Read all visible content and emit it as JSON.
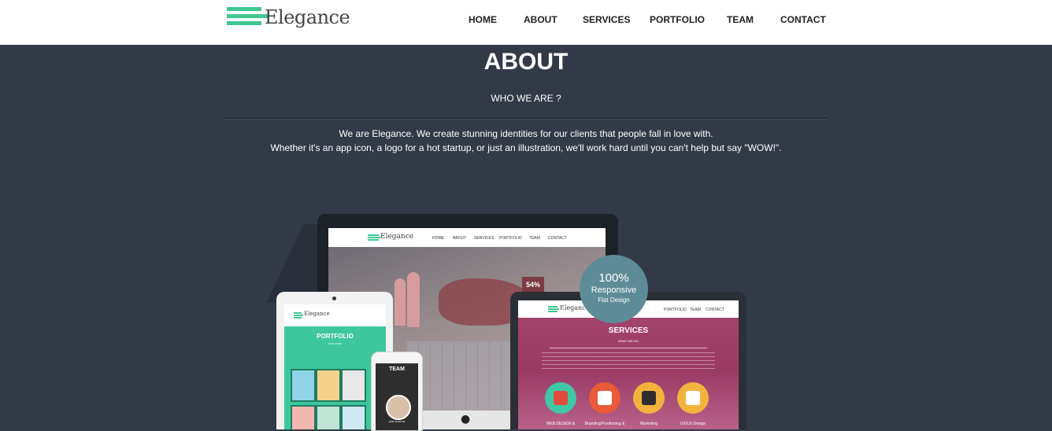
{
  "brand": {
    "logo_text": "Elegance"
  },
  "nav": {
    "items": [
      {
        "label": "HOME"
      },
      {
        "label": "ABOUT"
      },
      {
        "label": "SERVICES"
      },
      {
        "label": "PORTFOLIO"
      },
      {
        "label": "TEAM"
      },
      {
        "label": "CONTACT"
      }
    ]
  },
  "about": {
    "title": "ABOUT",
    "subtitle": "WHO WE ARE ?",
    "description_line1": "We are Elegance. We create stunning identities for our clients that people fall in love with.",
    "description_line2": "Whether it's an app icon, a logo for a hot startup, or just an illustration, we'll work hard until you can't help but say \"WOW!\"."
  },
  "illustration": {
    "badge_big": "100%",
    "badge_mid": "Responsive",
    "badge_small": "Flat Design",
    "laptop_percent": "54%",
    "mini_logo": "Elegance",
    "mini_nav": [
      "HOME",
      "ABOUT",
      "SERVICES",
      "PORTFOLIO",
      "TEAM",
      "CONTACT"
    ],
    "monitor_title": "SERVICES",
    "monitor_subtitle": "WHAT WE DO",
    "service_labels": [
      "WEB DESIGN &",
      "Branding/Positioning &",
      "Marketing",
      "UX/UX Design"
    ],
    "tablet_title": "PORTFOLIO",
    "tablet_subtitle": "OUR WORK",
    "phone_title": "TEAM",
    "phone_name": "JANE BARTON"
  },
  "colors": {
    "background": "#333a47",
    "accent": "#3fc88f",
    "navbar": "#ffffff"
  }
}
